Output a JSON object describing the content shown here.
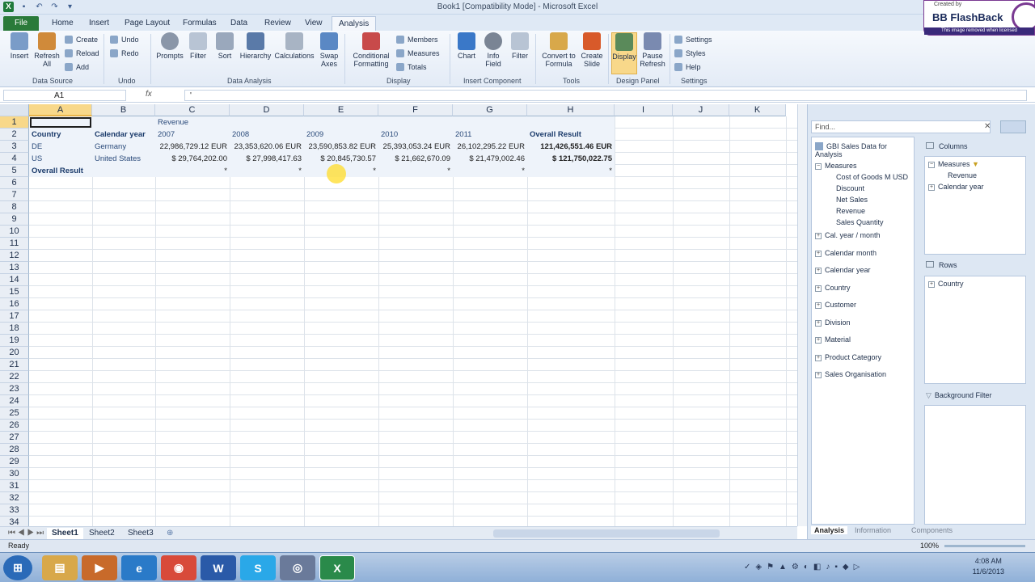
{
  "window": {
    "title": "Book1  [Compatibility Mode]  -  Microsoft Excel"
  },
  "watermark": {
    "created_by": "Created by",
    "brand": "BB FlashBack",
    "note": "This image removed when licensed"
  },
  "tabs": [
    "File",
    "Home",
    "Insert",
    "Page Layout",
    "Formulas",
    "Data",
    "Review",
    "View",
    "Analysis"
  ],
  "ribbon": {
    "data_source": {
      "label": "Data Source",
      "insert": "Insert",
      "refresh": "Refresh All",
      "create": "Create",
      "reload": "Reload",
      "add": "Add"
    },
    "undo": {
      "label": "Undo",
      "undo": "Undo",
      "redo": "Redo"
    },
    "data_analysis": {
      "label": "Data Analysis",
      "prompts": "Prompts",
      "filter": "Filter",
      "sort": "Sort",
      "hierarchy": "Hierarchy",
      "calculations": "Calculations",
      "swap": "Swap Axes"
    },
    "display": {
      "label": "Display",
      "conditional": "Conditional Formatting",
      "members": "Members",
      "measures": "Measures",
      "totals": "Totals"
    },
    "insert_component": {
      "label": "Insert Component",
      "chart": "Chart",
      "info_field": "Info Field",
      "filter": "Filter"
    },
    "tools": {
      "label": "Tools",
      "convert": "Convert to Formula",
      "create_slide": "Create Slide"
    },
    "design_panel": {
      "label": "Design Panel",
      "display": "Display",
      "pause": "Pause Refresh"
    },
    "settings": {
      "label": "Settings",
      "settings": "Settings",
      "styles": "Styles",
      "help": "Help"
    }
  },
  "formula_bar": {
    "name_box": "A1",
    "fx": "fx",
    "value": "'"
  },
  "columns": [
    "A",
    "B",
    "C",
    "D",
    "E",
    "F",
    "G",
    "H",
    "I",
    "J",
    "K"
  ],
  "rows": [
    "1",
    "2",
    "3",
    "4",
    "5",
    "6",
    "7",
    "8",
    "9",
    "10",
    "11",
    "12",
    "13",
    "14",
    "15",
    "16",
    "17",
    "18",
    "19",
    "20",
    "21",
    "22",
    "23",
    "24",
    "25",
    "26",
    "27",
    "28",
    "29",
    "30",
    "31",
    "32",
    "33",
    "34"
  ],
  "cells": {
    "C1": "Revenue",
    "A2": "Country",
    "B2": "Calendar year",
    "C2": "2007",
    "D2": "2008",
    "E2": "2009",
    "F2": "2010",
    "G2": "2011",
    "H2": "Overall Result",
    "A3": "DE",
    "B3": "Germany",
    "C3": "22,986,729.12 EUR",
    "D3": "23,353,620.06 EUR",
    "E3": "23,590,853.82 EUR",
    "F3": "25,393,053.24 EUR",
    "G3": "26,102,295.22 EUR",
    "H3": "121,426,551.46 EUR",
    "A4": "US",
    "B4": "United States",
    "C4": "$ 29,764,202.00",
    "D4": "$ 27,998,417.63",
    "E4": "$ 20,845,730.57",
    "F4": "$ 21,662,670.09",
    "G4": "$ 21,479,002.46",
    "H4": "$ 121,750,022.75",
    "A5": "Overall Result",
    "C5": "*",
    "D5": "*",
    "E5": "*",
    "F5": "*",
    "G5": "*",
    "H5": "*"
  },
  "sheets": [
    "Sheet1",
    "Sheet2",
    "Sheet3"
  ],
  "status": {
    "ready": "Ready",
    "zoom": "100%"
  },
  "pane": {
    "find_placeholder": "Find...",
    "source": "GBI Sales Data for Analysis",
    "measures_label": "Measures",
    "measures": [
      "Cost of Goods M USD",
      "Discount",
      "Net Sales",
      "Revenue",
      "Sales Quantity"
    ],
    "dimensions": [
      "Cal. year / month",
      "Calendar month",
      "Calendar year",
      "Country",
      "Customer",
      "Division",
      "Material",
      "Product Category",
      "Sales Organisation"
    ],
    "columns_label": "Columns",
    "columns_items": [
      "Measures",
      "Revenue",
      "Calendar year"
    ],
    "rows_label": "Rows",
    "rows_items": [
      "Country"
    ],
    "bg_filter_label": "Background Filter",
    "tabs": [
      "Analysis",
      "Information",
      "Components"
    ]
  },
  "taskbar": {
    "time": "4:08 AM",
    "date": "11/6/2013"
  }
}
